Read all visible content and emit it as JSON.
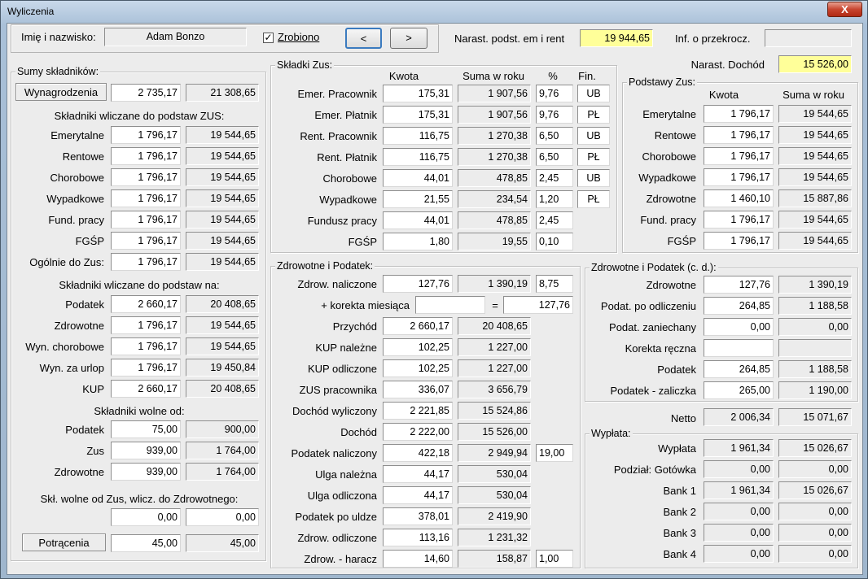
{
  "window": {
    "title": "Wyliczenia",
    "close_glyph": "X"
  },
  "top": {
    "name_label": "Imię i nazwisko:",
    "name_value": "Adam Bonzo",
    "done_label": "Zrobiono",
    "done_checked": "✓",
    "prev": "<",
    "next": ">",
    "narast_label": "Narast. podst. em i rent",
    "narast_value": "19 944,65",
    "inf_label": "Inf. o przekrocz.",
    "inf_value": "",
    "dochod_label": "Narast. Dochód",
    "dochod_value": "15 526,00"
  },
  "sumy": {
    "title": "Sumy składników:",
    "wyn_tab": "Wynagrodzenia",
    "wyn": [
      "2 735,17",
      "21 308,65"
    ],
    "zus_title": "Składniki wliczane do podstaw ZUS:",
    "zus_rows": [
      {
        "label": "Emerytalne",
        "kwota": "1 796,17",
        "suma": "19 544,65"
      },
      {
        "label": "Rentowe",
        "kwota": "1 796,17",
        "suma": "19 544,65"
      },
      {
        "label": "Chorobowe",
        "kwota": "1 796,17",
        "suma": "19 544,65"
      },
      {
        "label": "Wypadkowe",
        "kwota": "1 796,17",
        "suma": "19 544,65"
      },
      {
        "label": "Fund. pracy",
        "kwota": "1 796,17",
        "suma": "19 544,65"
      },
      {
        "label": "FGŚP",
        "kwota": "1 796,17",
        "suma": "19 544,65"
      },
      {
        "label": "Ogólnie do Zus:",
        "kwota": "1 796,17",
        "suma": "19 544,65"
      }
    ],
    "na_title": "Składniki wliczane do podstaw na:",
    "na_rows": [
      {
        "label": "Podatek",
        "kwota": "2 660,17",
        "suma": "20 408,65"
      },
      {
        "label": "Zdrowotne",
        "kwota": "1 796,17",
        "suma": "19 544,65"
      },
      {
        "label": "Wyn. chorobowe",
        "kwota": "1 796,17",
        "suma": "19 544,65"
      },
      {
        "label": "Wyn. za urlop",
        "kwota": "1 796,17",
        "suma": "19 450,84"
      },
      {
        "label": "KUP",
        "kwota": "2 660,17",
        "suma": "20 408,65"
      }
    ],
    "wolne_title": "Składniki wolne od:",
    "wolne_rows": [
      {
        "label": "Podatek",
        "kwota": "75,00",
        "suma": "900,00"
      },
      {
        "label": "Zus",
        "kwota": "939,00",
        "suma": "1 764,00"
      },
      {
        "label": "Zdrowotne",
        "kwota": "939,00",
        "suma": "1 764,00"
      }
    ],
    "skl_wolne_label": "Skł. wolne od Zus, wlicz. do Zdrowotnego:",
    "skl_wolne": [
      "0,00",
      "0,00"
    ],
    "potr_tab": "Potrącenia",
    "potr": [
      "45,00",
      "45,00"
    ]
  },
  "skladki": {
    "title": "Składki Zus:",
    "headers": [
      "Kwota",
      "Suma w roku",
      "%",
      "Fin."
    ],
    "rows": [
      {
        "label": "Emer. Pracownik",
        "kwota": "175,31",
        "suma": "1 907,56",
        "pct": "9,76",
        "fin": "UB"
      },
      {
        "label": "Emer. Płatnik",
        "kwota": "175,31",
        "suma": "1 907,56",
        "pct": "9,76",
        "fin": "PŁ"
      },
      {
        "label": "Rent. Pracownik",
        "kwota": "116,75",
        "suma": "1 270,38",
        "pct": "6,50",
        "fin": "UB"
      },
      {
        "label": "Rent. Płatnik",
        "kwota": "116,75",
        "suma": "1 270,38",
        "pct": "6,50",
        "fin": "PŁ"
      },
      {
        "label": "Chorobowe",
        "kwota": "44,01",
        "suma": "478,85",
        "pct": "2,45",
        "fin": "UB"
      },
      {
        "label": "Wypadkowe",
        "kwota": "21,55",
        "suma": "234,54",
        "pct": "1,20",
        "fin": "PŁ"
      },
      {
        "label": "Fundusz pracy",
        "kwota": "44,01",
        "suma": "478,85",
        "pct": "2,45",
        "fin": ""
      },
      {
        "label": "FGŚP",
        "kwota": "1,80",
        "suma": "19,55",
        "pct": "0,10",
        "fin": ""
      }
    ]
  },
  "podstawy": {
    "title": "Podstawy Zus:",
    "headers": [
      "Kwota",
      "Suma w roku"
    ],
    "rows": [
      {
        "label": "Emerytalne",
        "kwota": "1 796,17",
        "suma": "19 544,65"
      },
      {
        "label": "Rentowe",
        "kwota": "1 796,17",
        "suma": "19 544,65"
      },
      {
        "label": "Chorobowe",
        "kwota": "1 796,17",
        "suma": "19 544,65"
      },
      {
        "label": "Wypadkowe",
        "kwota": "1 796,17",
        "suma": "19 544,65"
      },
      {
        "label": "Zdrowotne",
        "kwota": "1 460,10",
        "suma": "15 887,86"
      },
      {
        "label": "Fund. pracy",
        "kwota": "1 796,17",
        "suma": "19 544,65"
      },
      {
        "label": "FGŚP",
        "kwota": "1 796,17",
        "suma": "19 544,65"
      }
    ]
  },
  "zdrow": {
    "title": "Zdrowotne i Podatek:",
    "naliczone": {
      "label": "Zdrow. naliczone",
      "kwota": "127,76",
      "suma": "1 390,19",
      "pct": "8,75"
    },
    "korekta": {
      "label": "+ korekta miesiąca",
      "value": "",
      "eq": "=",
      "result": "127,76"
    },
    "rows": [
      {
        "label": "Przychód",
        "kwota": "2 660,17",
        "suma": "20 408,65"
      },
      {
        "label": "KUP należne",
        "kwota": "102,25",
        "suma": "1 227,00"
      },
      {
        "label": "KUP odliczone",
        "kwota": "102,25",
        "suma": "1 227,00"
      },
      {
        "label": "ZUS pracownika",
        "kwota": "336,07",
        "suma": "3 656,79"
      },
      {
        "label": "Dochód wyliczony",
        "kwota": "2 221,85",
        "suma": "15 524,86"
      },
      {
        "label": "Dochód",
        "kwota": "2 222,00",
        "suma": "15 526,00"
      },
      {
        "label": "Podatek naliczony",
        "kwota": "422,18",
        "suma": "2 949,94",
        "pct": "19,00"
      },
      {
        "label": "Ulga należna",
        "kwota": "44,17",
        "suma": "530,04"
      },
      {
        "label": "Ulga odliczona",
        "kwota": "44,17",
        "suma": "530,04"
      },
      {
        "label": "Podatek po uldze",
        "kwota": "378,01",
        "suma": "2 419,90"
      },
      {
        "label": "Zdrow. odliczone",
        "kwota": "113,16",
        "suma": "1 231,32"
      },
      {
        "label": "Zdrow. - haracz",
        "kwota": "14,60",
        "suma": "158,87",
        "pct": "1,00"
      }
    ]
  },
  "zdrowcd": {
    "title": "Zdrowotne i Podatek (c. d.):",
    "rows": [
      {
        "label": "Zdrowotne",
        "kwota": "127,76",
        "suma": "1 390,19"
      },
      {
        "label": "Podat. po odliczeniu",
        "kwota": "264,85",
        "suma": "1 188,58"
      },
      {
        "label": "Podat. zaniechany",
        "kwota": "0,00",
        "suma": "0,00"
      },
      {
        "label": "Korekta ręczna",
        "kwota": "",
        "suma": ""
      },
      {
        "label": "Podatek",
        "kwota": "264,85",
        "suma": "1 188,58"
      },
      {
        "label": "Podatek - zaliczka",
        "kwota": "265,00",
        "suma": "1 190,00"
      }
    ]
  },
  "netto": {
    "label": "Netto",
    "kwota": "2 006,34",
    "suma": "15 071,67"
  },
  "wyplata": {
    "title": "Wypłata:",
    "rows": [
      {
        "label": "Wypłata",
        "kwota": "1 961,34",
        "suma": "15 026,67"
      },
      {
        "label": "Podział: Gotówka",
        "kwota": "0,00",
        "suma": "0,00"
      },
      {
        "label": "Bank 1",
        "kwota": "1 961,34",
        "suma": "15 026,67"
      },
      {
        "label": "Bank 2",
        "kwota": "0,00",
        "suma": "0,00"
      },
      {
        "label": "Bank 3",
        "kwota": "0,00",
        "suma": "0,00"
      },
      {
        "label": "Bank 4",
        "kwota": "0,00",
        "suma": "0,00"
      }
    ]
  },
  "colors": {
    "highlight": "#ffff99",
    "close": "#c8452f"
  }
}
